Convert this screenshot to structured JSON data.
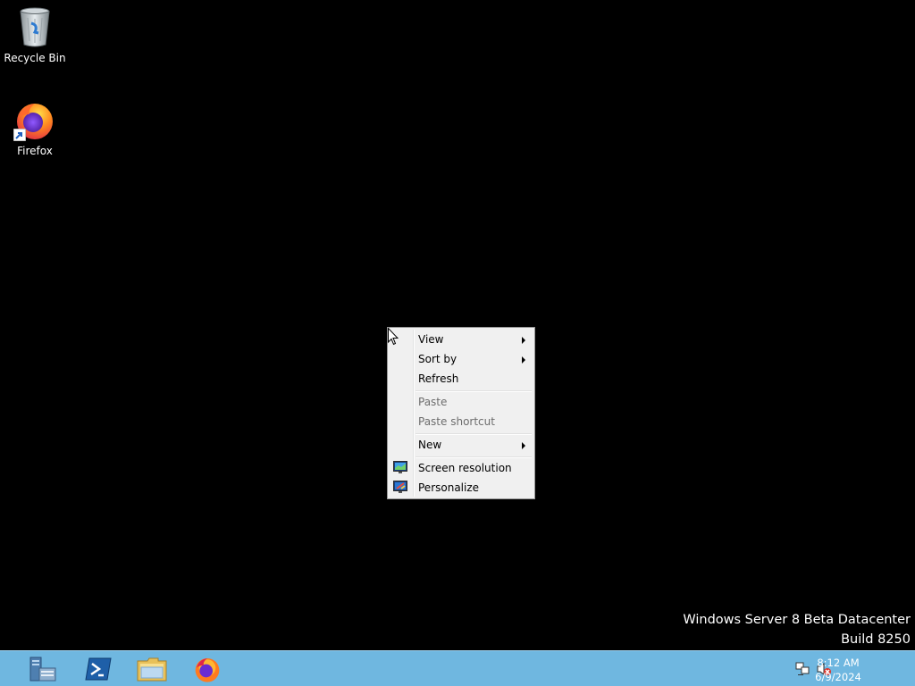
{
  "desktop": {
    "icons": [
      {
        "label": "Recycle Bin",
        "icon": "recycle-bin-icon"
      },
      {
        "label": "Firefox",
        "icon": "firefox-icon",
        "shortcut": true
      }
    ],
    "watermark": {
      "line1": "Windows Server 8 Beta Datacenter",
      "line2": "Build 8250"
    }
  },
  "context_menu": {
    "items": [
      {
        "label": "View",
        "submenu": true,
        "enabled": true
      },
      {
        "label": "Sort by",
        "submenu": true,
        "enabled": true
      },
      {
        "label": "Refresh",
        "enabled": true
      },
      {
        "label": "Paste",
        "enabled": false
      },
      {
        "label": "Paste shortcut",
        "enabled": false
      },
      {
        "label": "New",
        "submenu": true,
        "enabled": true
      },
      {
        "label": "Screen resolution",
        "icon": "screen-resolution-icon",
        "enabled": true
      },
      {
        "label": "Personalize",
        "icon": "personalize-icon",
        "enabled": true
      }
    ]
  },
  "taskbar": {
    "pinned": [
      {
        "name": "Server Manager",
        "icon": "server-manager-icon"
      },
      {
        "name": "Windows PowerShell",
        "icon": "powershell-icon"
      },
      {
        "name": "File Explorer",
        "icon": "file-explorer-icon"
      },
      {
        "name": "Firefox",
        "icon": "firefox-icon"
      }
    ],
    "tray": {
      "icons": [
        "network-icon",
        "volume-muted-icon"
      ],
      "time": "8:12 AM",
      "date": "6/9/2024"
    },
    "color": "#6fb7e0"
  }
}
